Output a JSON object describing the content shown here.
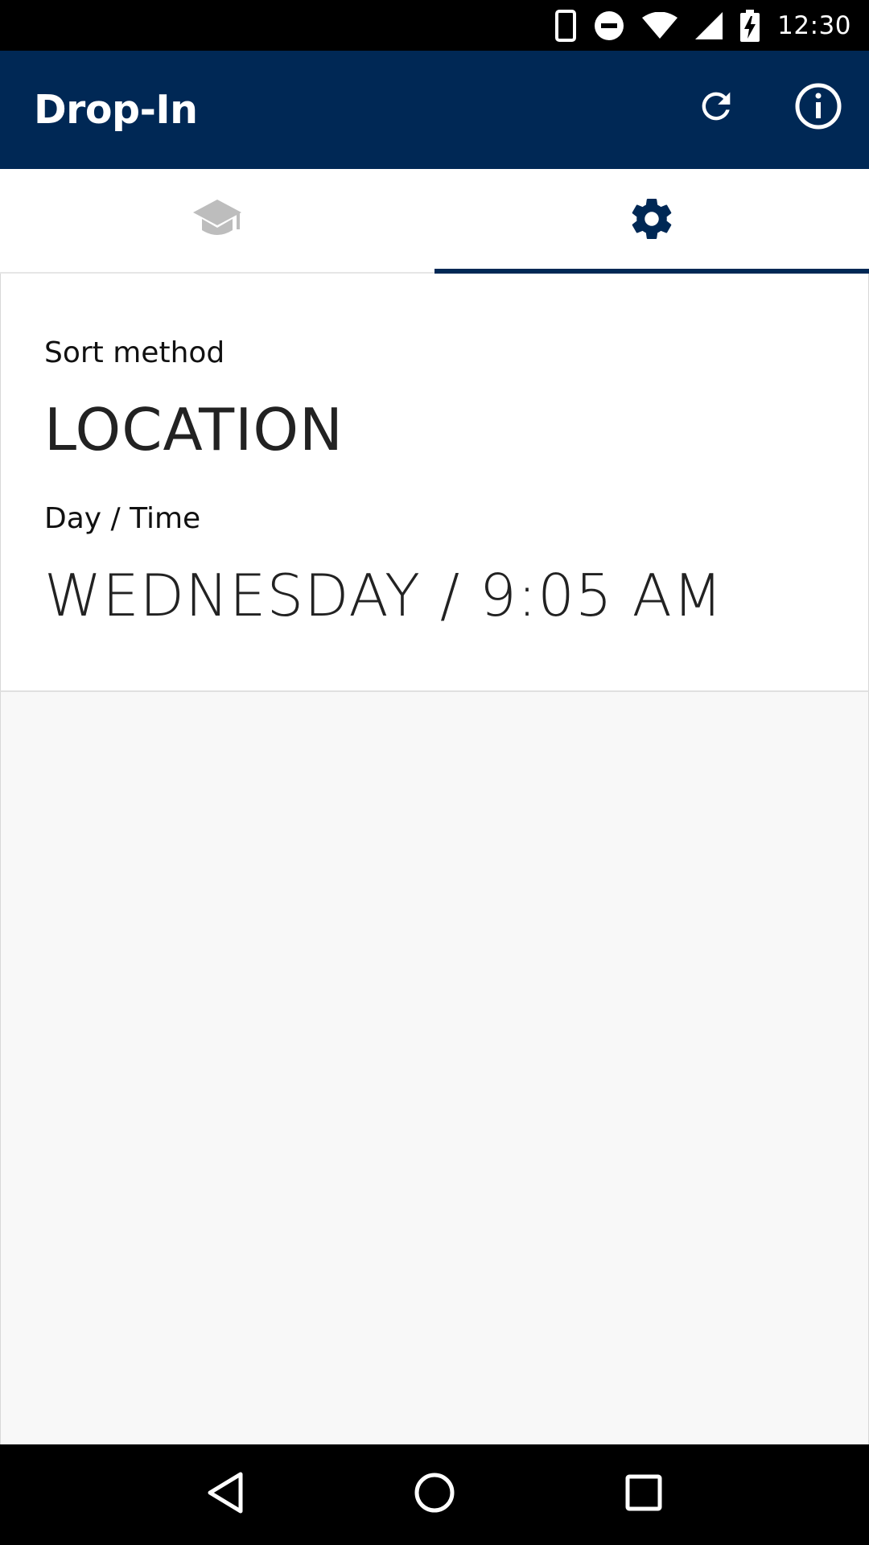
{
  "status_bar": {
    "time": "12:30",
    "icons": [
      "phone-vibrate-icon",
      "do-not-disturb-icon",
      "wifi-icon",
      "cell-signal-icon",
      "battery-charging-icon"
    ]
  },
  "app_bar": {
    "title": "Drop-In",
    "actions": [
      "refresh-icon",
      "info-icon"
    ]
  },
  "tabs": [
    {
      "icon": "graduation-cap-icon",
      "active": false
    },
    {
      "icon": "gear-icon",
      "active": true
    }
  ],
  "settings": {
    "sort_label": "Sort method",
    "sort_value": "LOCATION",
    "day_time_label": "Day / Time",
    "day_time_value": "WEDNESDAY / 9:05 AM"
  },
  "colors": {
    "primary": "#002855",
    "tab_inactive": "#bdbdbd",
    "background": "#fafafa"
  },
  "nav_bar": {
    "buttons": [
      "back-icon",
      "home-icon",
      "recents-icon"
    ]
  }
}
